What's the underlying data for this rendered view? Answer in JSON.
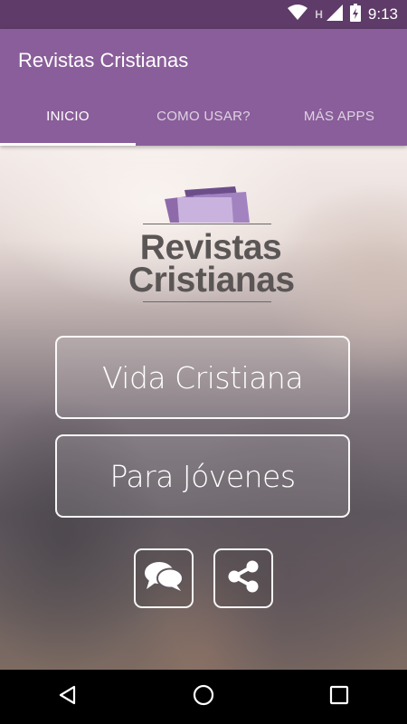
{
  "status_bar": {
    "time": "9:13",
    "network_letter": "H",
    "icons": [
      "wifi-icon",
      "signal-icon",
      "battery-icon"
    ]
  },
  "app_bar": {
    "title": "Revistas Cristianas",
    "color": "#8a5e9a",
    "status_color": "#5e3b68"
  },
  "tabs": [
    {
      "label": "INICIO",
      "active": true
    },
    {
      "label": "COMO USAR?",
      "active": false
    },
    {
      "label": "MÁS APPS",
      "active": false
    }
  ],
  "logo": {
    "line1": "Revistas",
    "line2": "Cristianas",
    "accent_color": "#b79ad0"
  },
  "buttons": {
    "vida_cristiana": "Vida Cristiana",
    "para_jovenes": "Para Jóvenes"
  },
  "icon_buttons": [
    "chat-icon",
    "share-icon"
  ],
  "nav_bar": [
    "back-icon",
    "home-icon",
    "recents-icon"
  ]
}
